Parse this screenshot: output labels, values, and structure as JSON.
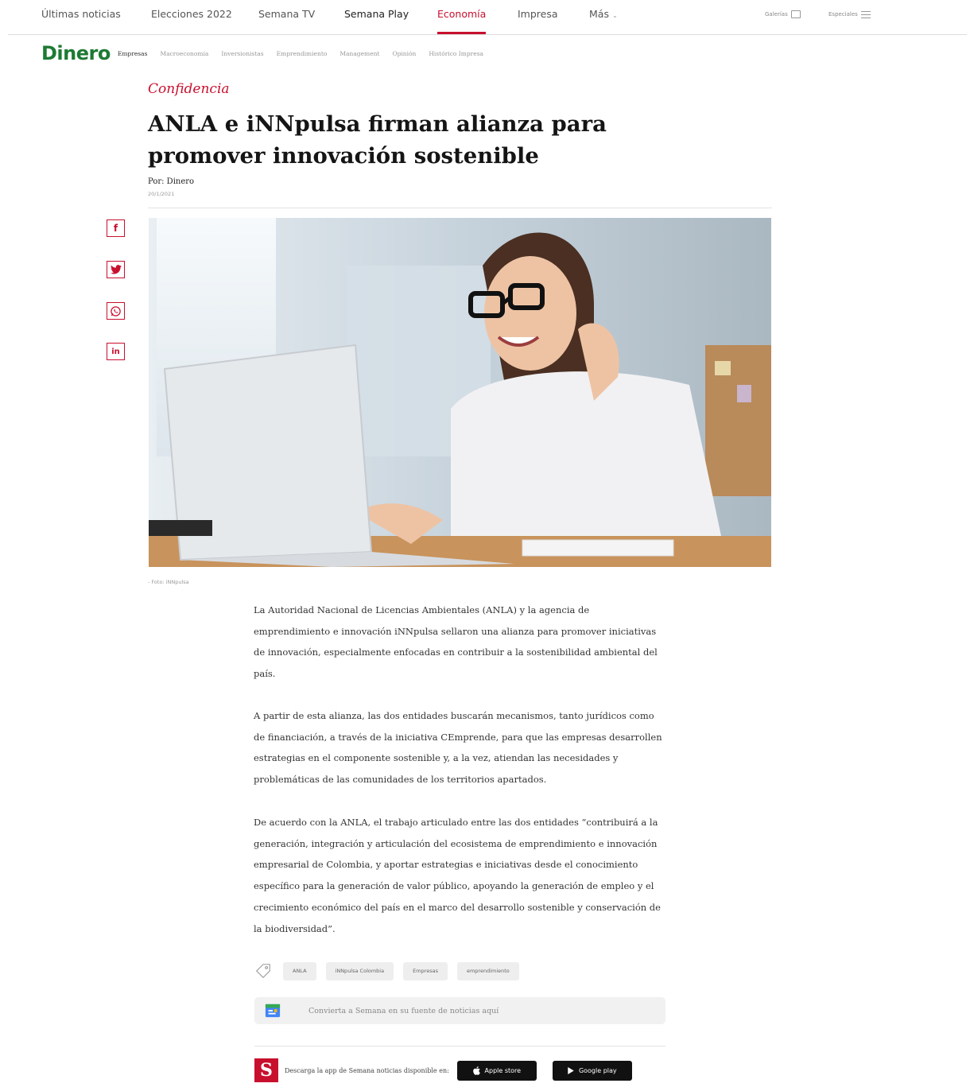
{
  "topnav": {
    "items": [
      "Últimas noticias",
      "Elecciones 2022",
      "Semana TV",
      "Semana Play",
      "Economía",
      "Impresa",
      "Más"
    ],
    "galerias": "Galerías",
    "especiales": "Especiales"
  },
  "subnav": {
    "logo": "Dinero",
    "items": [
      "Empresas",
      "Macroeconomía",
      "Inversionistas",
      "Emprendimiento",
      "Management",
      "Opinión",
      "Histórico Impresa"
    ]
  },
  "article": {
    "kicker": "Confidencia",
    "headline": "ANLA e iNNpulsa firman alianza para promover innovación sostenible",
    "byline": "Por: Dinero",
    "date": "20/1/2021",
    "caption": "- Foto: iNNpulsa",
    "paragraphs": [
      "La Autoridad Nacional de Licencias Ambientales (ANLA) y la agencia de emprendimiento e innovación iNNpulsa sellaron una alianza para promover iniciativas de innovación, especialmente enfocadas en contribuir a la sostenibilidad ambiental del país.",
      "A partir de esta alianza, las dos entidades buscarán mecanismos, tanto jurídicos como de financiación, a través de la iniciativa CEmprende, para que las empresas desarrollen estrategias en el componente sostenible y, a la vez, atiendan las necesidades y problemáticas de las comunidades de los territorios apartados.",
      "De acuerdo con la ANLA, el trabajo articulado entre las dos entidades “contribuirá a la generación, integración y articulación del ecosistema de emprendimiento e innovación empresarial de Colombia, y aportar estrategias e iniciativas desde el conocimiento específico para la generación de valor público, apoyando la generación de empleo y el crecimiento económico del país en el marco del desarrollo sostenible y conservación de la biodiversidad”."
    ]
  },
  "tags": [
    "ANLA",
    "iNNpulsa Colombia",
    "Empresas",
    "emprendimiento"
  ],
  "gnews": {
    "text": "Convierta a Semana en su fuente de noticias aquí"
  },
  "app": {
    "text": "Descarga la app de Semana noticias disponible en:",
    "apple": "Apple store",
    "google": "Google play"
  },
  "social": {
    "facebook": "f",
    "linkedin": "in"
  },
  "colors": {
    "accent": "#c8102e",
    "brand_green": "#1d7a34"
  }
}
